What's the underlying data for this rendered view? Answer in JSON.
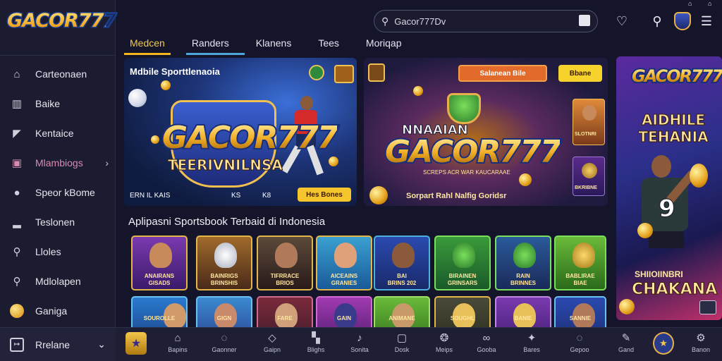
{
  "app": {
    "logo_text": "GACOR777"
  },
  "search": {
    "value": "Gacor777Dv"
  },
  "tabs": [
    {
      "label": "Medcen",
      "active": true
    },
    {
      "label": "Randers",
      "active": false
    },
    {
      "label": "Klanens",
      "active": false
    },
    {
      "label": "Tees",
      "active": false
    },
    {
      "label": "Moriqap",
      "active": false
    }
  ],
  "sidebar": {
    "items": [
      {
        "label": "Carteonaen",
        "icon": "home-icon"
      },
      {
        "label": "Baike",
        "icon": "building-icon"
      },
      {
        "label": "Kentaice",
        "icon": "megaphone-icon"
      },
      {
        "label": "Mlambiogs",
        "icon": "chat-icon",
        "active": true
      },
      {
        "label": "Speor kBome",
        "icon": "soccer-ball-icon"
      },
      {
        "label": "Teslonen",
        "icon": "car-icon"
      },
      {
        "label": "Lloles",
        "icon": "search-icon"
      },
      {
        "label": "Mdlolapen",
        "icon": "search-icon"
      },
      {
        "label": "Ganiga",
        "icon": "coin-icon"
      }
    ],
    "footer_label": "Rrelane"
  },
  "banners": {
    "banner1": {
      "title": "Mdbile Sporttlenaoia",
      "logo": "GACOR777",
      "subtitle": "TEERIVNILNSA",
      "bottom_left": "ERN IL KAIS",
      "bottom_mid1": "KS",
      "bottom_mid2": "K8",
      "button": "Hes Bones"
    },
    "banner2": {
      "top_button": "Salanean Bile",
      "top_right": "Bbane",
      "heading": "NNAAIAN",
      "logo": "GACOR777",
      "subtitle": "SCREPS ACR WAR KAUCARAAE",
      "bottom": "Sorpart Rahl Nalfig Goridsr",
      "side_card1": "SLOTNRI",
      "side_card2": "BKRIBNE"
    },
    "banner3": {
      "logo": "GACOR777",
      "heading": "AIDHILE TEHANIA",
      "jersey_number": "9",
      "footer_small": "SHIIOIINBRI",
      "footer_big": "CHAKANA"
    }
  },
  "section": {
    "title": "Aplipasni Sportsbook Terbaid di Indonesia"
  },
  "games_row1": [
    {
      "title": "ANAIRANS",
      "sub": "GISADS"
    },
    {
      "title": "BAINRIGS",
      "sub": "BRINSHIS"
    },
    {
      "title": "TIFRRACE",
      "sub": "BRIOS"
    },
    {
      "title": "AICEAINS",
      "sub": "GRANIES"
    },
    {
      "title": "BAI",
      "sub": "BRINS 202"
    },
    {
      "title": "BIRAINEN",
      "sub": "GRINSARS"
    },
    {
      "title": "RAIN",
      "sub": "BRINNES"
    },
    {
      "title": "BABLIRAE",
      "sub": "BIAE"
    }
  ],
  "games_row2": [
    {
      "title": "SOUROLLE"
    },
    {
      "title": "GIGN"
    },
    {
      "title": "FARE"
    },
    {
      "title": "GAIN"
    },
    {
      "title": "ANIMANE"
    },
    {
      "title": "SOUGHL"
    },
    {
      "title": "BANIE"
    },
    {
      "title": "SANNIE"
    }
  ],
  "bottom_nav": [
    {
      "label": "Bapins",
      "icon": "home-icon"
    },
    {
      "label": "Gaonner",
      "icon": "chat-icon"
    },
    {
      "label": "Gaipn",
      "icon": "cube-icon"
    },
    {
      "label": "Blighs",
      "icon": "bookmark-icon"
    },
    {
      "label": "Sonita",
      "icon": "music-icon"
    },
    {
      "label": "Dosk",
      "icon": "square-icon"
    },
    {
      "label": "Meips",
      "icon": "ball-icon"
    },
    {
      "label": "Gooba",
      "icon": "infinity-icon"
    },
    {
      "label": "Bares",
      "icon": "star-icon"
    },
    {
      "label": "Gepoo",
      "icon": "chat-icon"
    },
    {
      "label": "Gand",
      "icon": "edit-icon"
    },
    {
      "label": "Banon",
      "icon": "gear-icon"
    }
  ],
  "colors": {
    "accent": "#f2b51c",
    "sidebar_bg": "#1b1c30",
    "page_bg": "#14152a",
    "active_sidebar": "#d58bb0",
    "tab_underline_blue": "#4ea6dd"
  }
}
